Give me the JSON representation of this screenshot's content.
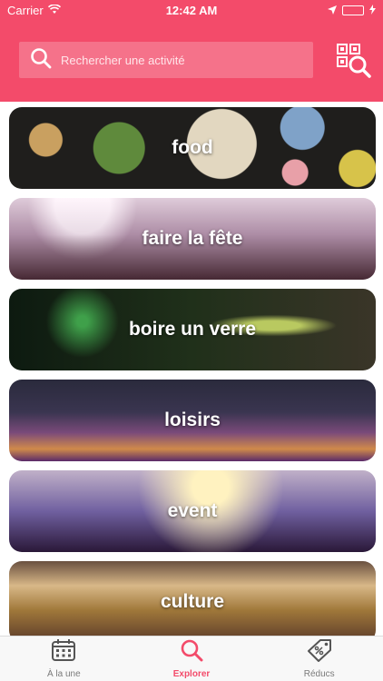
{
  "status_bar": {
    "carrier": "Carrier",
    "time": "12:42 AM",
    "battery_color": "#4cd964"
  },
  "header": {
    "background": "#f34b6a"
  },
  "search": {
    "placeholder": "Rechercher une activité",
    "icon": "search-icon"
  },
  "qr_scanner": {
    "icon": "qr-scan-icon"
  },
  "categories": [
    {
      "label": "food"
    },
    {
      "label": "faire la fête"
    },
    {
      "label": "boire un verre"
    },
    {
      "label": "loisirs"
    },
    {
      "label": "event"
    },
    {
      "label": "culture"
    }
  ],
  "tabs": [
    {
      "label": "À la une",
      "icon": "calendar-icon",
      "active": false
    },
    {
      "label": "Explorer",
      "icon": "search-icon",
      "active": true
    },
    {
      "label": "Réducs",
      "icon": "discount-tag-icon",
      "active": false
    }
  ],
  "accent_color": "#f34b6a"
}
